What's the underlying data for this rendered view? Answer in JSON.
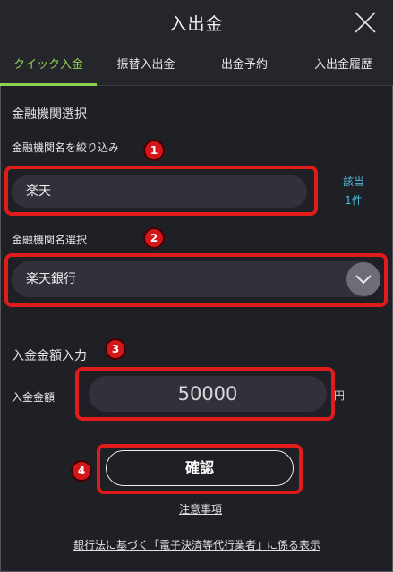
{
  "header": {
    "title": "入出金"
  },
  "tabs": [
    {
      "label": "クイック入金"
    },
    {
      "label": "振替入出金"
    },
    {
      "label": "出金予約"
    },
    {
      "label": "入出金履歴"
    }
  ],
  "bank_select": {
    "section_title": "金融機関選択",
    "filter_label": "金融機関名を絞り込み",
    "filter_value": "楽天",
    "match_line1": "該当",
    "match_line2": "1件",
    "name_label": "金融機関名選択",
    "selected_bank": "楽天銀行"
  },
  "amount": {
    "section_title": "入金金額入力",
    "label": "入金金額",
    "value": "50000",
    "unit": "円"
  },
  "actions": {
    "confirm_label": "確認",
    "notes_link": "注意事項",
    "legal_link": "銀行法に基づく「電子決済等代行業者」に係る表示"
  },
  "annotations": [
    "1",
    "2",
    "3",
    "4"
  ],
  "colors": {
    "background": "#1f2025",
    "active_tab": "#8fd14f",
    "highlight_box": "#e01b1b",
    "match_count": "#4fb8d8"
  },
  "icons": {
    "close": "close-icon",
    "dropdown": "chevron-down-icon"
  }
}
